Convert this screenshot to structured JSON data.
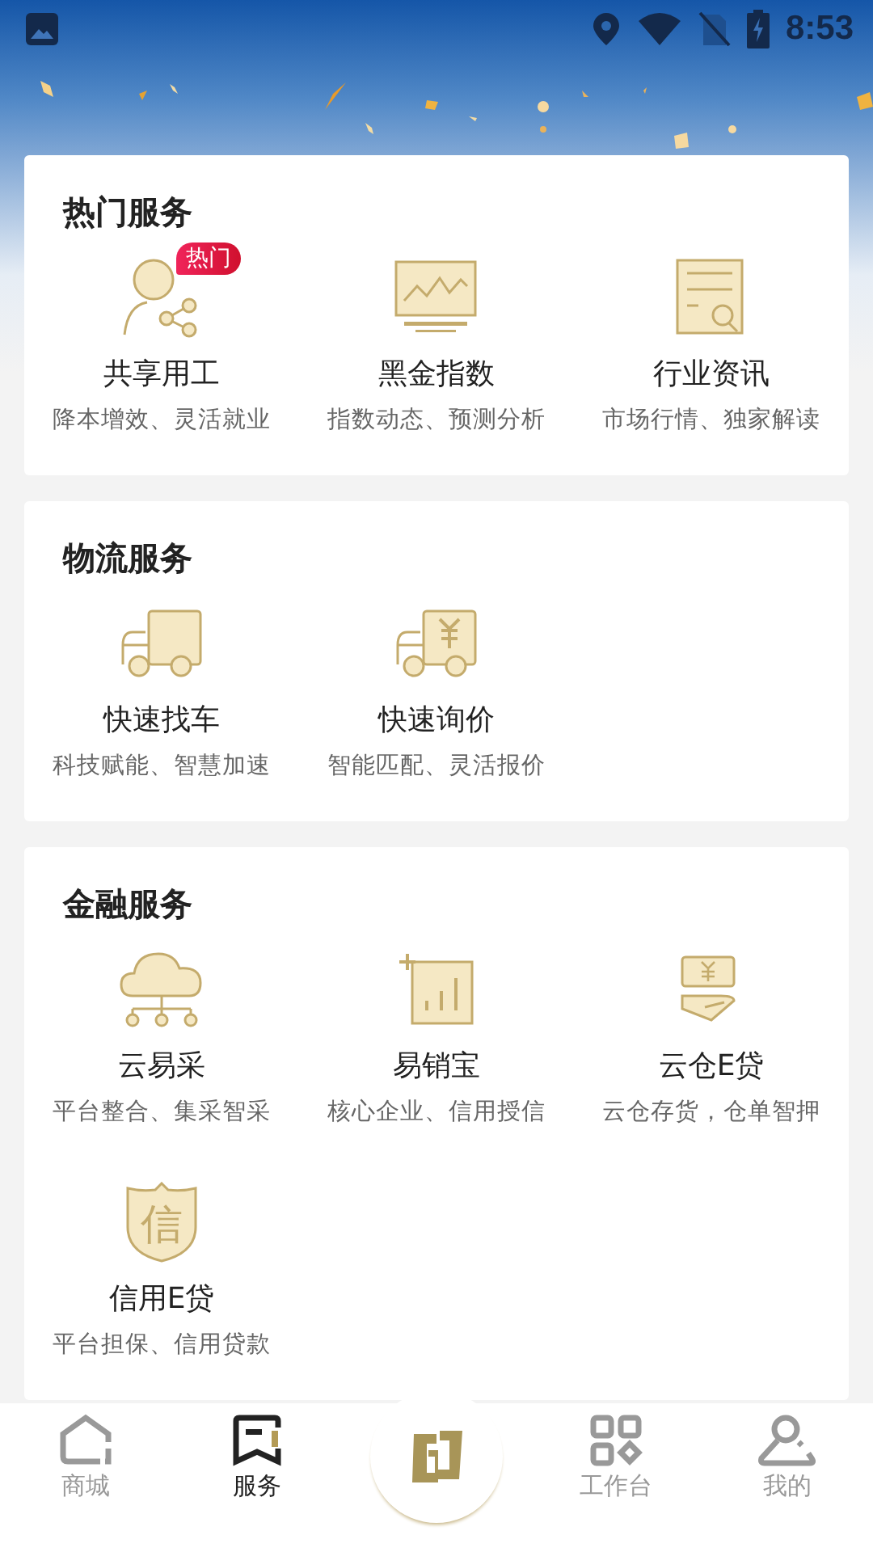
{
  "status_bar": {
    "time": "8:53"
  },
  "sections": [
    {
      "title": "热门服务",
      "items": [
        {
          "title": "共享用工",
          "subtitle": "降本增效、灵活就业",
          "badge": "热门"
        },
        {
          "title": "黑金指数",
          "subtitle": "指数动态、预测分析"
        },
        {
          "title": "行业资讯",
          "subtitle": "市场行情、独家解读"
        }
      ]
    },
    {
      "title": "物流服务",
      "items": [
        {
          "title": "快速找车",
          "subtitle": "科技赋能、智慧加速"
        },
        {
          "title": "快速询价",
          "subtitle": "智能匹配、灵活报价"
        }
      ]
    },
    {
      "title": "金融服务",
      "items": [
        {
          "title": "云易采",
          "subtitle": "平台整合、集采智采"
        },
        {
          "title": "易销宝",
          "subtitle": "核心企业、信用授信"
        },
        {
          "title": "云仓E贷",
          "subtitle": "云仓存货，仓单智押"
        },
        {
          "title": "信用E贷",
          "subtitle": "平台担保、信用贷款",
          "icon_char": "信"
        }
      ]
    }
  ],
  "bottom_nav": [
    {
      "label": "商城",
      "selected": false
    },
    {
      "label": "服务",
      "selected": true
    },
    {
      "kind": "logo"
    },
    {
      "label": "工作台",
      "selected": false
    },
    {
      "label": "我的",
      "selected": false
    }
  ]
}
